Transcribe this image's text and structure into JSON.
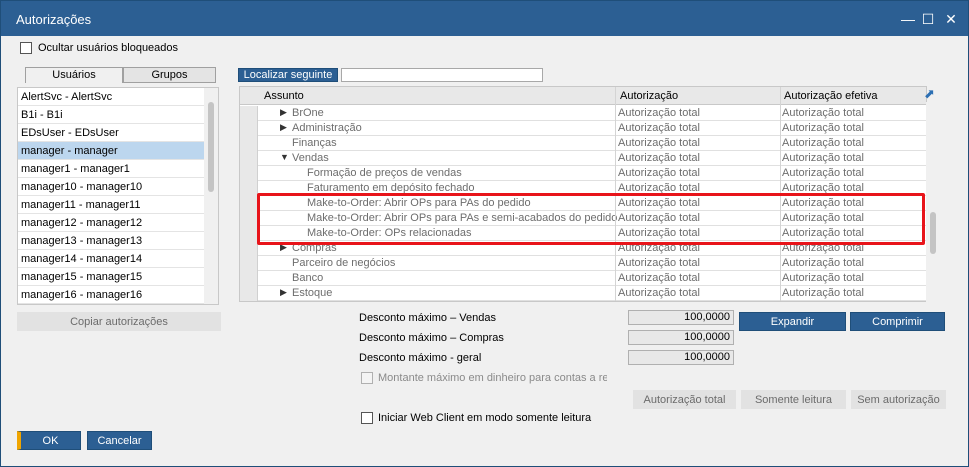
{
  "window": {
    "title": "Autorizações"
  },
  "options": {
    "hide_blocked_label": "Ocultar usuários bloqueados",
    "hide_blocked_checked": false
  },
  "tabs": [
    {
      "label": "Usuários",
      "active": true
    },
    {
      "label": "Grupos",
      "active": false
    }
  ],
  "users": [
    "AlertSvc - AlertSvc",
    "B1i - B1i",
    "EDsUser - EDsUser",
    "manager - manager",
    "manager1 - manager1",
    "manager10 - manager10",
    "manager11 - manager11",
    "manager12 - manager12",
    "manager13 - manager13",
    "manager14 - manager14",
    "manager15 - manager15",
    "manager16 - manager16"
  ],
  "selected_user_index": 3,
  "copy_button": "Copiar autorizações",
  "search": {
    "button": "Localizar seguinte",
    "value": ""
  },
  "grid": {
    "columns": [
      "Assunto",
      "Autorização",
      "Autorização efetiva"
    ],
    "rows": [
      {
        "subject": "BrOne",
        "auth": "Autorização total",
        "effective": "Autorização total"
      },
      {
        "subject": "Administração",
        "auth": "Autorização total",
        "effective": "Autorização total"
      },
      {
        "subject": "Finanças",
        "auth": "Autorização total",
        "effective": "Autorização total"
      },
      {
        "subject": "Vendas",
        "auth": "Autorização total",
        "effective": "Autorização total"
      },
      {
        "subject": "Formação de preços de vendas",
        "auth": "Autorização total",
        "effective": "Autorização total"
      },
      {
        "subject": "Faturamento em depósito fechado",
        "auth": "Autorização total",
        "effective": "Autorização total"
      },
      {
        "subject": "Make-to-Order: Abrir OPs para PAs do pedido",
        "auth": "Autorização total",
        "effective": "Autorização total"
      },
      {
        "subject": "Make-to-Order: Abrir OPs para PAs e semi-acabados do pedido",
        "auth": "Autorização total",
        "effective": "Autorização total"
      },
      {
        "subject": "Make-to-Order: OPs relacionadas",
        "auth": "Autorização total",
        "effective": "Autorização total"
      },
      {
        "subject": "Compras",
        "auth": "Autorização total",
        "effective": "Autorização total"
      },
      {
        "subject": "Parceiro de negócios",
        "auth": "Autorização total",
        "effective": "Autorização total"
      },
      {
        "subject": "Banco",
        "auth": "Autorização total",
        "effective": "Autorização total"
      },
      {
        "subject": "Estoque",
        "auth": "Autorização total",
        "effective": "Autorização total"
      }
    ]
  },
  "discounts": [
    {
      "label": "Desconto máximo – Vendas",
      "value": "100,0000"
    },
    {
      "label": "Desconto máximo – Compras",
      "value": "100,0000"
    },
    {
      "label": "Desconto máximo - geral",
      "value": "100,0000"
    }
  ],
  "max_cash_label": "Montante máximo em dinheiro para contas a recebe",
  "webclient_label": "Iniciar Web Client em modo somente leitura",
  "buttons": {
    "expand": "Expandir",
    "collapse": "Comprimir",
    "full_auth": "Autorização total",
    "read_only": "Somente leitura",
    "no_auth": "Sem autorização",
    "ok": "OK",
    "cancel": "Cancelar"
  },
  "colors": {
    "titlebar": "#2c5f93",
    "selected_row": "#bcd6ee",
    "highlight": "#e8141a",
    "ok_accent": "#f0a500"
  }
}
